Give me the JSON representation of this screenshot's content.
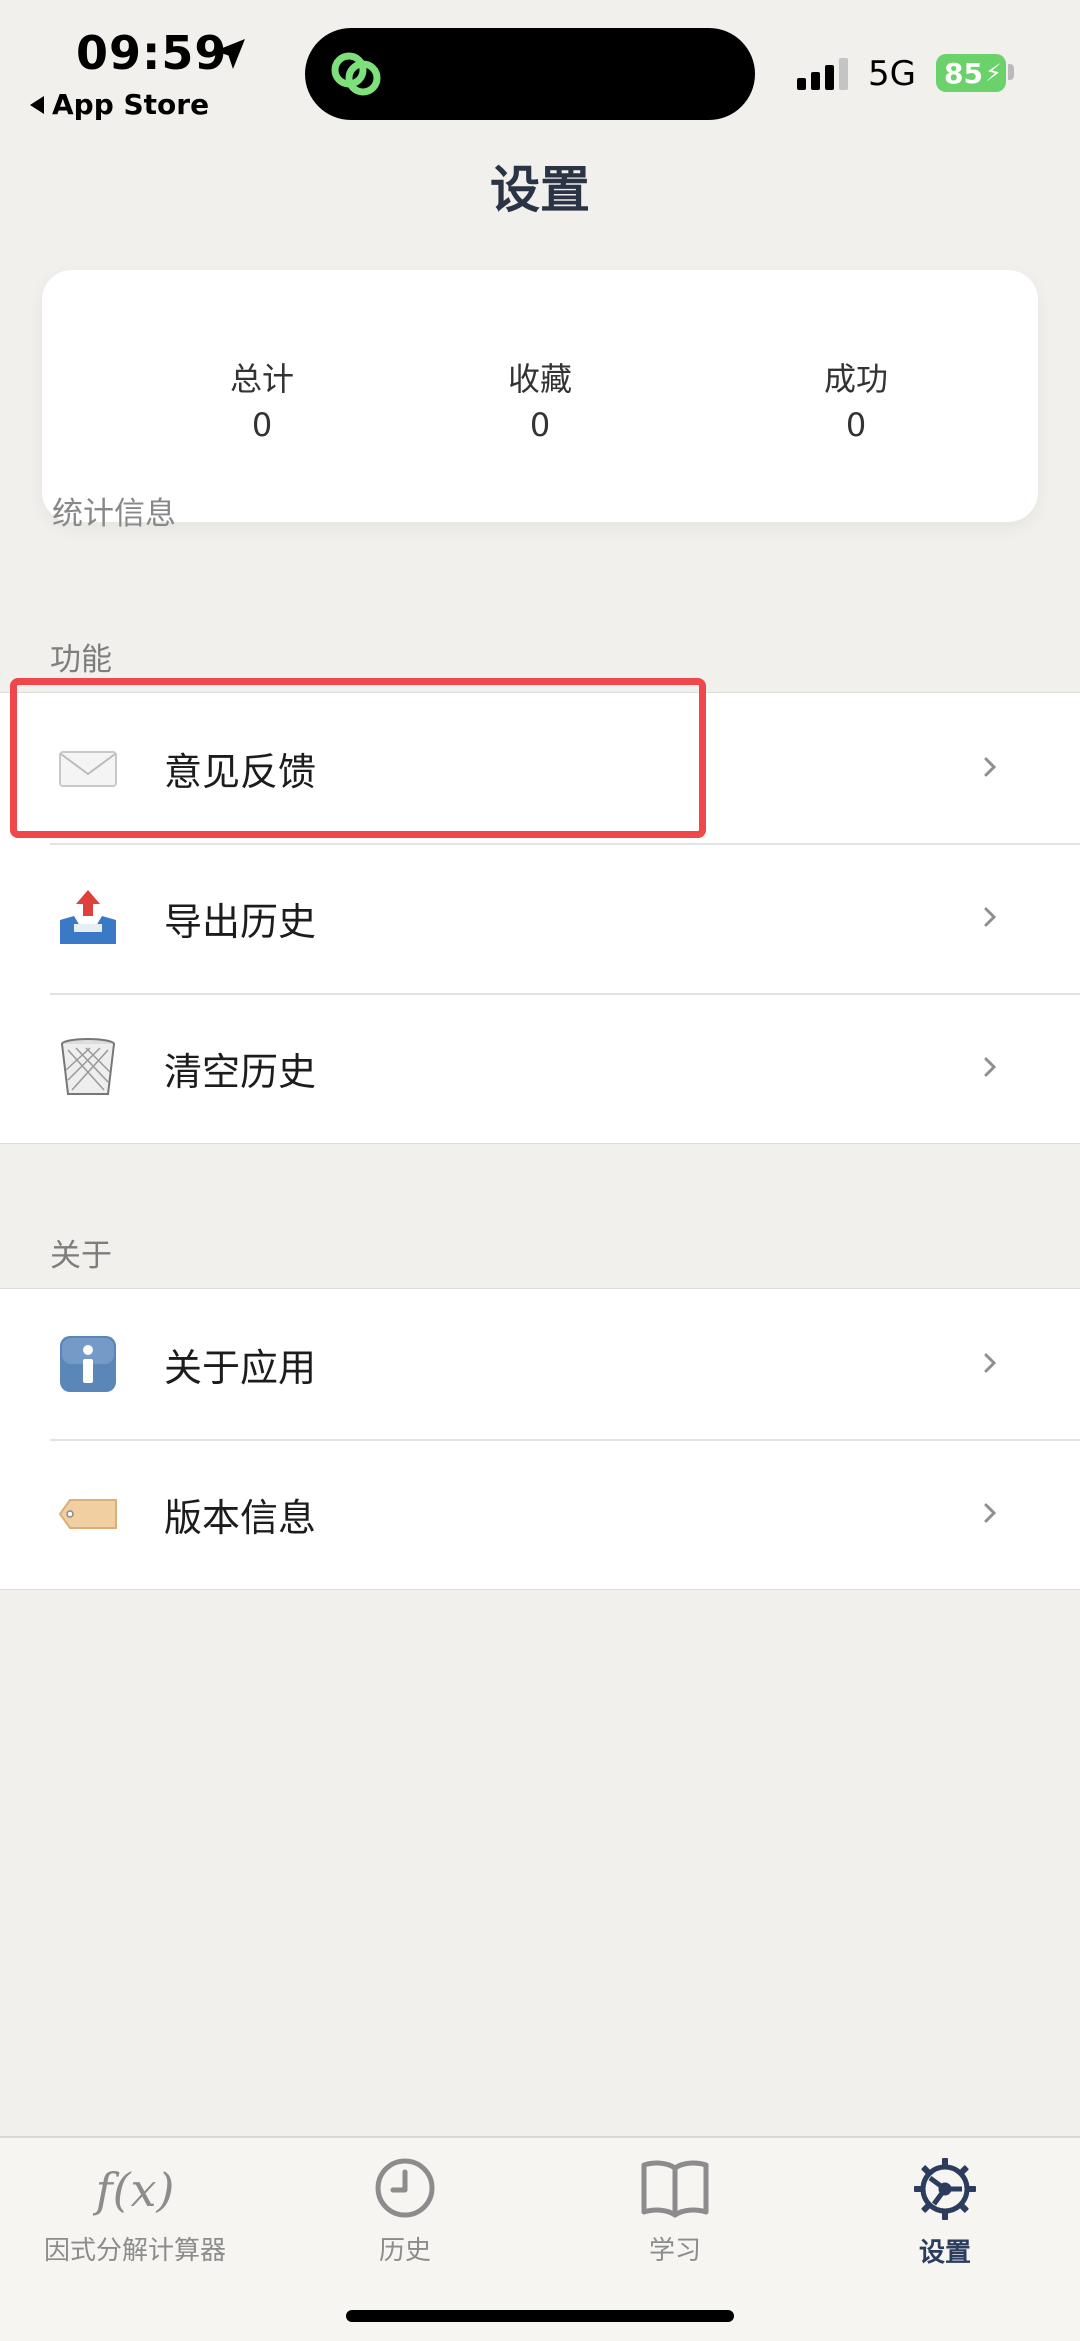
{
  "status_bar": {
    "time": "09:59",
    "back_app": "App Store",
    "network": "5G",
    "battery": "85"
  },
  "page": {
    "title": "设置"
  },
  "stats": {
    "caption": "统计信息",
    "items": [
      {
        "label": "总计",
        "value": "0"
      },
      {
        "label": "收藏",
        "value": "0"
      },
      {
        "label": "成功",
        "value": "0"
      }
    ]
  },
  "sections": {
    "features": {
      "header": "功能",
      "items": [
        {
          "label": "意见反馈",
          "icon": "envelope-icon"
        },
        {
          "label": "导出历史",
          "icon": "outbox-tray-icon"
        },
        {
          "label": "清空历史",
          "icon": "wastebasket-icon"
        }
      ]
    },
    "about": {
      "header": "关于",
      "items": [
        {
          "label": "关于应用",
          "icon": "info-icon"
        },
        {
          "label": "版本信息",
          "icon": "label-tag-icon"
        }
      ]
    }
  },
  "tabbar": {
    "tabs": [
      {
        "label": "因式分解计算器",
        "icon": "function-fx-icon"
      },
      {
        "label": "历史",
        "icon": "clock-icon"
      },
      {
        "label": "学习",
        "icon": "book-icon"
      },
      {
        "label": "设置",
        "icon": "gear-icon",
        "active": true
      }
    ]
  },
  "colors": {
    "highlight": "#f0474c",
    "active_tab": "#2b3c5c",
    "battery": "#6bd26b"
  }
}
